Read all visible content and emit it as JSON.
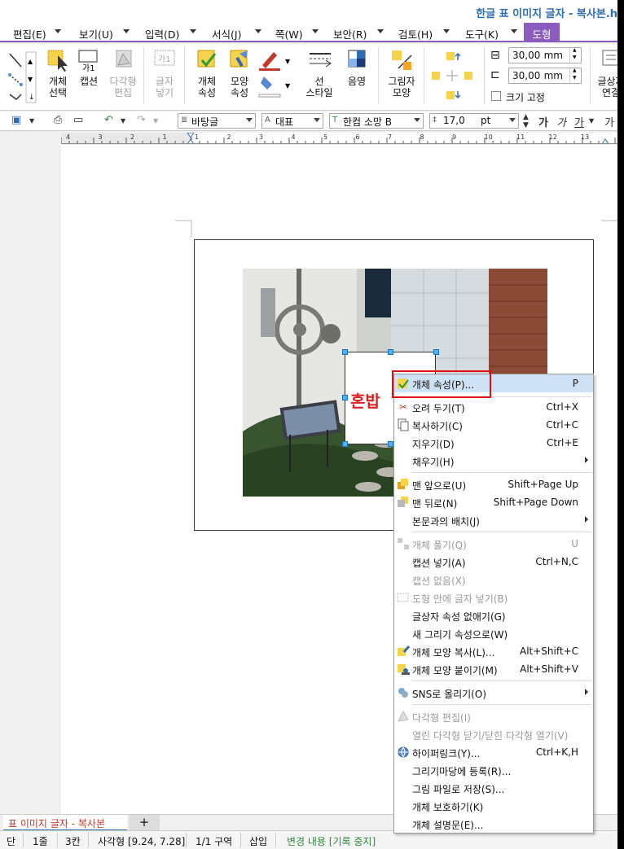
{
  "window": {
    "title": "한글 표 이미지 글자 - 복사본.h"
  },
  "menubar": {
    "items": [
      "편집(E)",
      "보기(U)",
      "입력(D)",
      "서식(J)",
      "쪽(W)",
      "보안(R)",
      "검토(H)",
      "도구(K)"
    ],
    "active_tab": "도형"
  },
  "ribbon": {
    "object_select": "개체\n선택",
    "caption": "캡션",
    "caption_icon_text": "가1",
    "polygon_edit": "다각형\n편집",
    "insert_text": "글자\n넣기",
    "insert_text_icon": "가1",
    "object_props": "개체\n속성",
    "shape_props": "모양\n속성",
    "line_style": "선\n스타일",
    "shadow": "음영",
    "picture_shape": "그림자\n모양",
    "width_value": "30,00",
    "height_value": "30,00",
    "unit": "mm",
    "fixed_size": "크기 고정",
    "text_wrap": "글상자\n연결"
  },
  "format_toolbar": {
    "style": "바탕글",
    "lang": "대표",
    "font": "한컴 소망 B",
    "size": "17,0",
    "size_unit": "pt",
    "bold_glyph": "가",
    "italic_glyph": "가",
    "underline_glyph": "가"
  },
  "ruler": {
    "numbers": [
      "4",
      "3",
      "2",
      "1",
      "1",
      "2",
      "3",
      "4",
      "5",
      "6",
      "7",
      "8",
      "9",
      "10",
      "11",
      "12",
      "13"
    ]
  },
  "document": {
    "shape_text": "혼밥"
  },
  "context_menu": {
    "items": [
      {
        "label": "개체 속성(P)...",
        "shortcut": "P",
        "icon": "object-props-icon",
        "highlighted": true
      },
      {
        "label": "오려 두기(T)",
        "shortcut": "Ctrl+X",
        "icon": "scissors-icon"
      },
      {
        "label": "복사하기(C)",
        "shortcut": "Ctrl+C",
        "icon": "copy-icon"
      },
      {
        "label": "지우기(D)",
        "shortcut": "Ctrl+E"
      },
      {
        "label": "채우기(H)",
        "submenu": true
      },
      {
        "label": "맨 앞으로(U)",
        "shortcut": "Shift+Page Up",
        "icon": "bring-front-icon"
      },
      {
        "label": "맨 뒤로(N)",
        "shortcut": "Shift+Page Down",
        "icon": "send-back-icon"
      },
      {
        "label": "본문과의 배치(J)",
        "submenu": true
      },
      {
        "label": "개체 풀기(Q)",
        "shortcut": "U",
        "disabled": true,
        "icon": "ungroup-icon"
      },
      {
        "label": "캡션 넣기(A)",
        "shortcut": "Ctrl+N,C"
      },
      {
        "label": "캡션 없음(X)",
        "disabled": true
      },
      {
        "label": "도형 안에 글자 넣기(B)",
        "disabled": true,
        "icon": "shape-text-icon"
      },
      {
        "label": "글상자 속성 없애기(G)"
      },
      {
        "label": "새 그리기 속성으로(W)"
      },
      {
        "label": "개체 모양 복사(L)...",
        "shortcut": "Alt+Shift+C",
        "icon": "copy-format-icon"
      },
      {
        "label": "개체 모양 붙이기(M)",
        "shortcut": "Alt+Shift+V",
        "icon": "paste-format-icon"
      },
      {
        "label": "SNS로 올리기(O)",
        "submenu": true,
        "icon": "sns-icon"
      },
      {
        "label": "다각형 편집(I)",
        "disabled": true,
        "icon": "polygon-icon"
      },
      {
        "label": "열린 다각형 닫기/닫힌 다각형 열기(V)",
        "disabled": true
      },
      {
        "label": "하이퍼링크(Y)...",
        "shortcut": "Ctrl+K,H",
        "icon": "globe-icon"
      },
      {
        "label": "그리기마당에 등록(R)..."
      },
      {
        "label": "그림 파일로 저장(S)..."
      },
      {
        "label": "개체 보호하기(K)"
      },
      {
        "label": "개체 설명문(E)..."
      }
    ]
  },
  "tabs": {
    "active": "표 이미지 글자 - 복사본",
    "add": "+"
  },
  "statusbar": {
    "page": "단",
    "line": "1줄",
    "col": "3칸",
    "shape": "사각형 [9.24, 7.28]",
    "section": "1/1 구역",
    "mode": "삽입",
    "changes": "변경 내용 [기록 중지]"
  },
  "colors": {
    "accent": "#8a5cc0",
    "title": "#2e6cb4",
    "highlight": "#cfe1f4",
    "red_box": "#e01010"
  }
}
